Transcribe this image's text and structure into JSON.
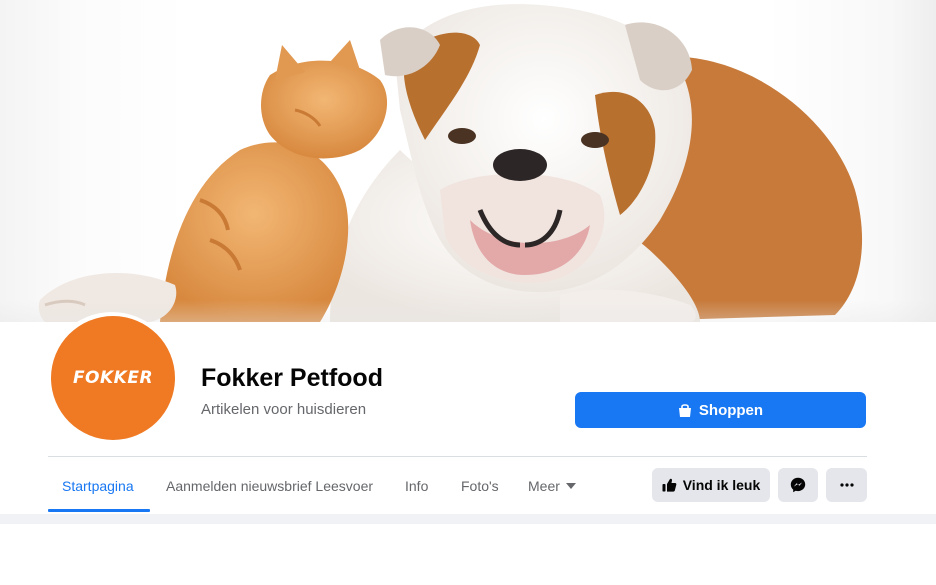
{
  "page": {
    "name": "Fokker Petfood",
    "category": "Artikelen voor huisdieren",
    "avatar_logo_text": "FOKKER",
    "cover_image": "bulldog-and-kitten-photo"
  },
  "actions": {
    "shop_label": "Shoppen",
    "like_label": "Vind ik leuk"
  },
  "tabs": [
    {
      "label": "Startpagina",
      "active": true
    },
    {
      "label": "Aanmelden nieuwsbrief Leesvoer",
      "active": false
    },
    {
      "label": "Info",
      "active": false
    },
    {
      "label": "Foto's",
      "active": false
    },
    {
      "label": "Meer",
      "active": false
    }
  ],
  "colors": {
    "accent": "#1877f2",
    "avatar_bg": "#ef7a23",
    "secondary_button": "#e4e6eb",
    "secondary_text": "#65676b"
  },
  "icons": {
    "shop": "shopping-bag-icon",
    "like": "thumbs-up-icon",
    "messenger": "messenger-icon",
    "more": "ellipsis-icon",
    "meer_dropdown": "caret-down-icon"
  }
}
